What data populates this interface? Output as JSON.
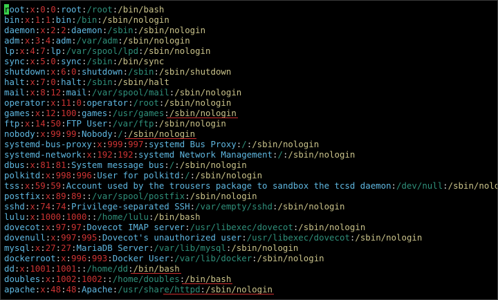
{
  "terminal": {
    "lines": [
      {
        "user": "root",
        "x": "x",
        "uid": "0",
        "gid": "0",
        "desc": "root",
        "home": "/root",
        "shell": "/bin/bash"
      },
      {
        "user": "bin",
        "x": "x",
        "uid": "1",
        "gid": "1",
        "desc": "bin",
        "home": "/bin",
        "shell": "/sbin/nologin"
      },
      {
        "user": "daemon",
        "x": "x",
        "uid": "2",
        "gid": "2",
        "desc": "daemon",
        "home": "/sbin",
        "shell": "/sbin/nologin"
      },
      {
        "user": "adm",
        "x": "x",
        "uid": "3",
        "gid": "4",
        "desc": "adm",
        "home": "/var/adm",
        "shell": "/sbin/nologin"
      },
      {
        "user": "lp",
        "x": "x",
        "uid": "4",
        "gid": "7",
        "desc": "lp",
        "home": "/var/spool/lpd",
        "shell": "/sbin/nologin"
      },
      {
        "user": "sync",
        "x": "x",
        "uid": "5",
        "gid": "0",
        "desc": "sync",
        "home": "/sbin",
        "shell": "/bin/sync"
      },
      {
        "user": "shutdown",
        "x": "x",
        "uid": "6",
        "gid": "0",
        "desc": "shutdown",
        "home": "/sbin",
        "shell": "/sbin/shutdown"
      },
      {
        "user": "halt",
        "x": "x",
        "uid": "7",
        "gid": "0",
        "desc": "halt",
        "home": "/sbin",
        "shell": "/sbin/halt"
      },
      {
        "user": "mail",
        "x": "x",
        "uid": "8",
        "gid": "12",
        "desc": "mail",
        "home": "/var/spool/mail",
        "shell": "/sbin/nologin"
      },
      {
        "user": "operator",
        "x": "x",
        "uid": "11",
        "gid": "0",
        "desc": "operator",
        "home": "/root",
        "shell": "/sbin/nologin"
      },
      {
        "user": "games",
        "x": "x",
        "uid": "12",
        "gid": "100",
        "desc": "games",
        "home": "/usr/games",
        "shell": "/sbin/nologin"
      },
      {
        "user": "ftp",
        "x": "x",
        "uid": "14",
        "gid": "50",
        "desc": "FTP User",
        "home": "/var/ftp",
        "shell": "/sbin/nologin"
      },
      {
        "user": "nobody",
        "x": "x",
        "uid": "99",
        "gid": "99",
        "desc": "Nobody",
        "home": "/",
        "shell": "/sbin/nologin"
      },
      {
        "user": "systemd-bus-proxy",
        "x": "x",
        "uid": "999",
        "gid": "997",
        "desc": "systemd Bus Proxy",
        "home": "/",
        "shell": "/sbin/nologin"
      },
      {
        "user": "systemd-network",
        "x": "x",
        "uid": "192",
        "gid": "192",
        "desc": "systemd Network Management",
        "home": "/",
        "shell": "/sbin/nologin"
      },
      {
        "user": "dbus",
        "x": "x",
        "uid": "81",
        "gid": "81",
        "desc": "System message bus",
        "home": "/",
        "shell": "/sbin/nologin"
      },
      {
        "user": "polkitd",
        "x": "x",
        "uid": "998",
        "gid": "996",
        "desc": "User for polkitd",
        "home": "/",
        "shell": "/sbin/nologin"
      },
      {
        "user": "tss",
        "x": "x",
        "uid": "59",
        "gid": "59",
        "desc": "Account used by the trousers package to sandbox the tcsd daemon",
        "home": "/dev/null",
        "shell": "/sbin/nologin"
      },
      {
        "user": "postfix",
        "x": "x",
        "uid": "89",
        "gid": "89",
        "desc": "",
        "home": "/var/spool/postfix",
        "shell": "/sbin/nologin"
      },
      {
        "user": "sshd",
        "x": "x",
        "uid": "74",
        "gid": "74",
        "desc": "Privilege-separated SSH",
        "home": "/var/empty/sshd",
        "shell": "/sbin/nologin"
      },
      {
        "user": "lulu",
        "x": "x",
        "uid": "1000",
        "gid": "1000",
        "desc": "",
        "home": "/home/lulu",
        "shell": "/bin/bash"
      },
      {
        "user": "dovecot",
        "x": "x",
        "uid": "97",
        "gid": "97",
        "desc": "Dovecot IMAP server",
        "home": "/usr/libexec/dovecot",
        "shell": "/sbin/nologin"
      },
      {
        "user": "dovenull",
        "x": "x",
        "uid": "997",
        "gid": "995",
        "desc": "Dovecot's unauthorized user",
        "home": "/usr/libexec/dovecot",
        "shell": "/sbin/nologin"
      },
      {
        "user": "mysql",
        "x": "x",
        "uid": "27",
        "gid": "27",
        "desc": "MariaDB Server",
        "home": "/var/lib/mysql",
        "shell": "/sbin/nologin"
      },
      {
        "user": "dockerroot",
        "x": "x",
        "uid": "996",
        "gid": "993",
        "desc": "Docker User",
        "home": "/var/lib/docker",
        "shell": "/sbin/nologin"
      },
      {
        "user": "dd",
        "x": "x",
        "uid": "1001",
        "gid": "1001",
        "desc": "",
        "home": "/home/dd",
        "shell": "/bin/bash"
      },
      {
        "user": "doubles",
        "x": "x",
        "uid": "1002",
        "gid": "1002",
        "desc": "",
        "home": "/home/doubles",
        "shell": "/bin/bash"
      },
      {
        "user": "apache",
        "x": "x",
        "uid": "48",
        "gid": "48",
        "desc": "Apache",
        "home": "/usr/share/httpd",
        "shell": "/sbin/nologin"
      }
    ],
    "separator": ":",
    "colors": {
      "background": "#000000",
      "username": "#5fb7e0",
      "separator": "#cfcfcf",
      "ids": "#cc3333",
      "description": "#5fb7e0",
      "home": "#2f8f7a",
      "shell": "#c9c28a",
      "cursor": "#39d24a",
      "annotation_underline": "#d03030"
    },
    "annotated_lines": [
      10,
      12,
      25,
      26,
      27
    ]
  }
}
